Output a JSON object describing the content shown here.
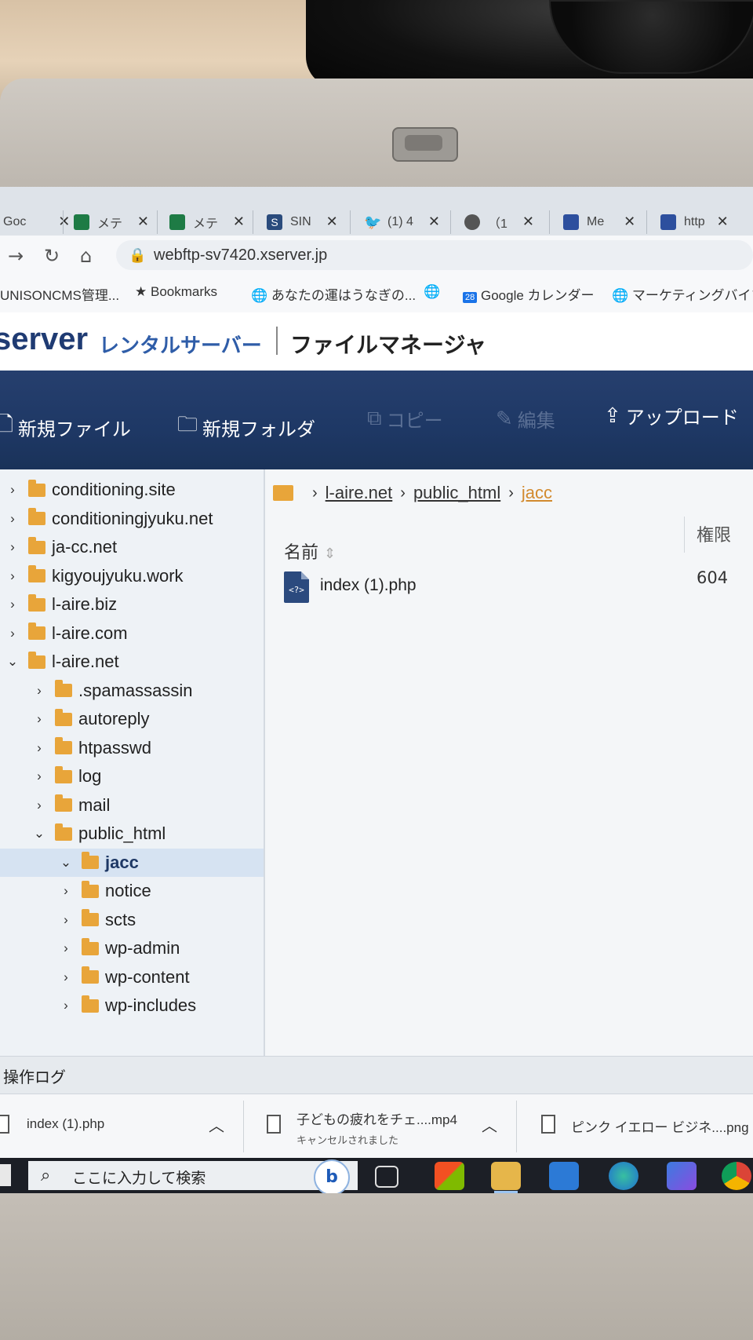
{
  "browser": {
    "tabs": [
      {
        "label": "Goc",
        "fav": "#ffffff"
      },
      {
        "label": "メテ",
        "fav": "#1e7b45"
      },
      {
        "label": "メテ",
        "fav": "#1e7b45"
      },
      {
        "label": "SIN",
        "fav": "#2a4b7c"
      },
      {
        "label": "(1) 4",
        "fav": "#1d9bf0"
      },
      {
        "label": "（1",
        "fav": "#555555"
      },
      {
        "label": "Me",
        "fav": "#2d4f9e"
      },
      {
        "label": "http",
        "fav": "#2d4f9e"
      }
    ],
    "close_glyph": "✕",
    "url": "webftp-sv7420.xserver.jp",
    "bookmarks": [
      {
        "label": "UNISONCMS管理..."
      },
      {
        "label": "Bookmarks",
        "icon": "★"
      },
      {
        "label": "あなたの運はうなぎの...",
        "icon": "🌐"
      },
      {
        "label": "",
        "icon": "🌐"
      },
      {
        "label": "Google カレンダー",
        "icon": "28"
      },
      {
        "label": "マーケティングバイブル",
        "icon": "🌐"
      }
    ]
  },
  "app": {
    "logo": "server",
    "logo_sub": "レンタルサーバー",
    "title": "ファイルマネージャ",
    "toolbar": {
      "new_file": "新規ファイル",
      "new_folder": "新規フォルダ",
      "copy": "コピー",
      "edit": "編集",
      "upload": "アップロード"
    }
  },
  "tree": [
    {
      "label": "conditioning.site",
      "depth": 0,
      "open": false
    },
    {
      "label": "conditioningjyuku.net",
      "depth": 0,
      "open": false
    },
    {
      "label": "ja-cc.net",
      "depth": 0,
      "open": false
    },
    {
      "label": "kigyoujyuku.work",
      "depth": 0,
      "open": false
    },
    {
      "label": "l-aire.biz",
      "depth": 0,
      "open": false
    },
    {
      "label": "l-aire.com",
      "depth": 0,
      "open": false
    },
    {
      "label": "l-aire.net",
      "depth": 0,
      "open": true
    },
    {
      "label": ".spamassassin",
      "depth": 1,
      "open": false
    },
    {
      "label": "autoreply",
      "depth": 1,
      "open": false
    },
    {
      "label": "htpasswd",
      "depth": 1,
      "open": false
    },
    {
      "label": "log",
      "depth": 1,
      "open": false
    },
    {
      "label": "mail",
      "depth": 1,
      "open": false
    },
    {
      "label": "public_html",
      "depth": 1,
      "open": true
    },
    {
      "label": "jacc",
      "depth": 2,
      "open": true,
      "selected": true
    },
    {
      "label": "notice",
      "depth": 2,
      "open": false
    },
    {
      "label": "scts",
      "depth": 2,
      "open": false
    },
    {
      "label": "wp-admin",
      "depth": 2,
      "open": false
    },
    {
      "label": "wp-content",
      "depth": 2,
      "open": false
    },
    {
      "label": "wp-includes",
      "depth": 2,
      "open": false
    }
  ],
  "breadcrumb": {
    "items": [
      "l-aire.net",
      "public_html"
    ],
    "current": "jacc"
  },
  "files": {
    "col_name": "名前",
    "col_perm": "権限",
    "sort_glyph": "⇕",
    "rows": [
      {
        "name": "index (1).php",
        "perm": "604",
        "icon_text": "<?>"
      }
    ]
  },
  "oplog": "操作ログ",
  "downloads": [
    {
      "name": "index (1).php",
      "sub": ""
    },
    {
      "name": "子どもの疲れをチェ....mp4",
      "sub": "キャンセルされました"
    },
    {
      "name": "ピンク イエロー ビジネ....png",
      "sub": ""
    }
  ],
  "taskbar": {
    "search_placeholder": "ここに入力して検索",
    "bing": "b"
  }
}
